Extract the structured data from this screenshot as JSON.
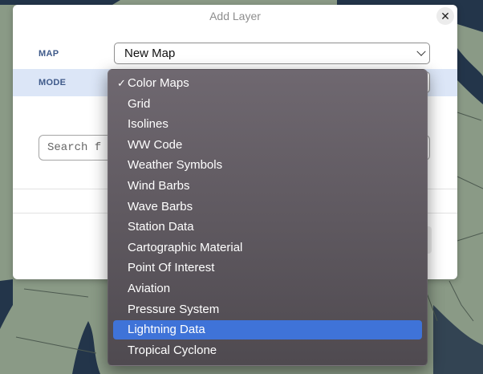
{
  "dialog": {
    "title": "Add Layer",
    "close_symbol": "✕",
    "map_label": "MAP",
    "map_value": "New Map",
    "mode_label": "MODE",
    "search_placeholder": "Search f"
  },
  "dropdown": {
    "checked_index": 0,
    "highlighted_index": 12,
    "check_symbol": "✓",
    "options": [
      "Color Maps",
      "Grid",
      "Isolines",
      "WW Code",
      "Weather Symbols",
      "Wind Barbs",
      "Wave Barbs",
      "Station Data",
      "Cartographic Material",
      "Point Of Interest",
      "Aviation",
      "Pressure System",
      "Lightning Data",
      "Tropical Cyclone"
    ]
  },
  "colors": {
    "map_land": "#8a9a86",
    "map_sea": "#23354a",
    "highlight": "#3f73d8",
    "mode_row": "#dce6f7"
  }
}
